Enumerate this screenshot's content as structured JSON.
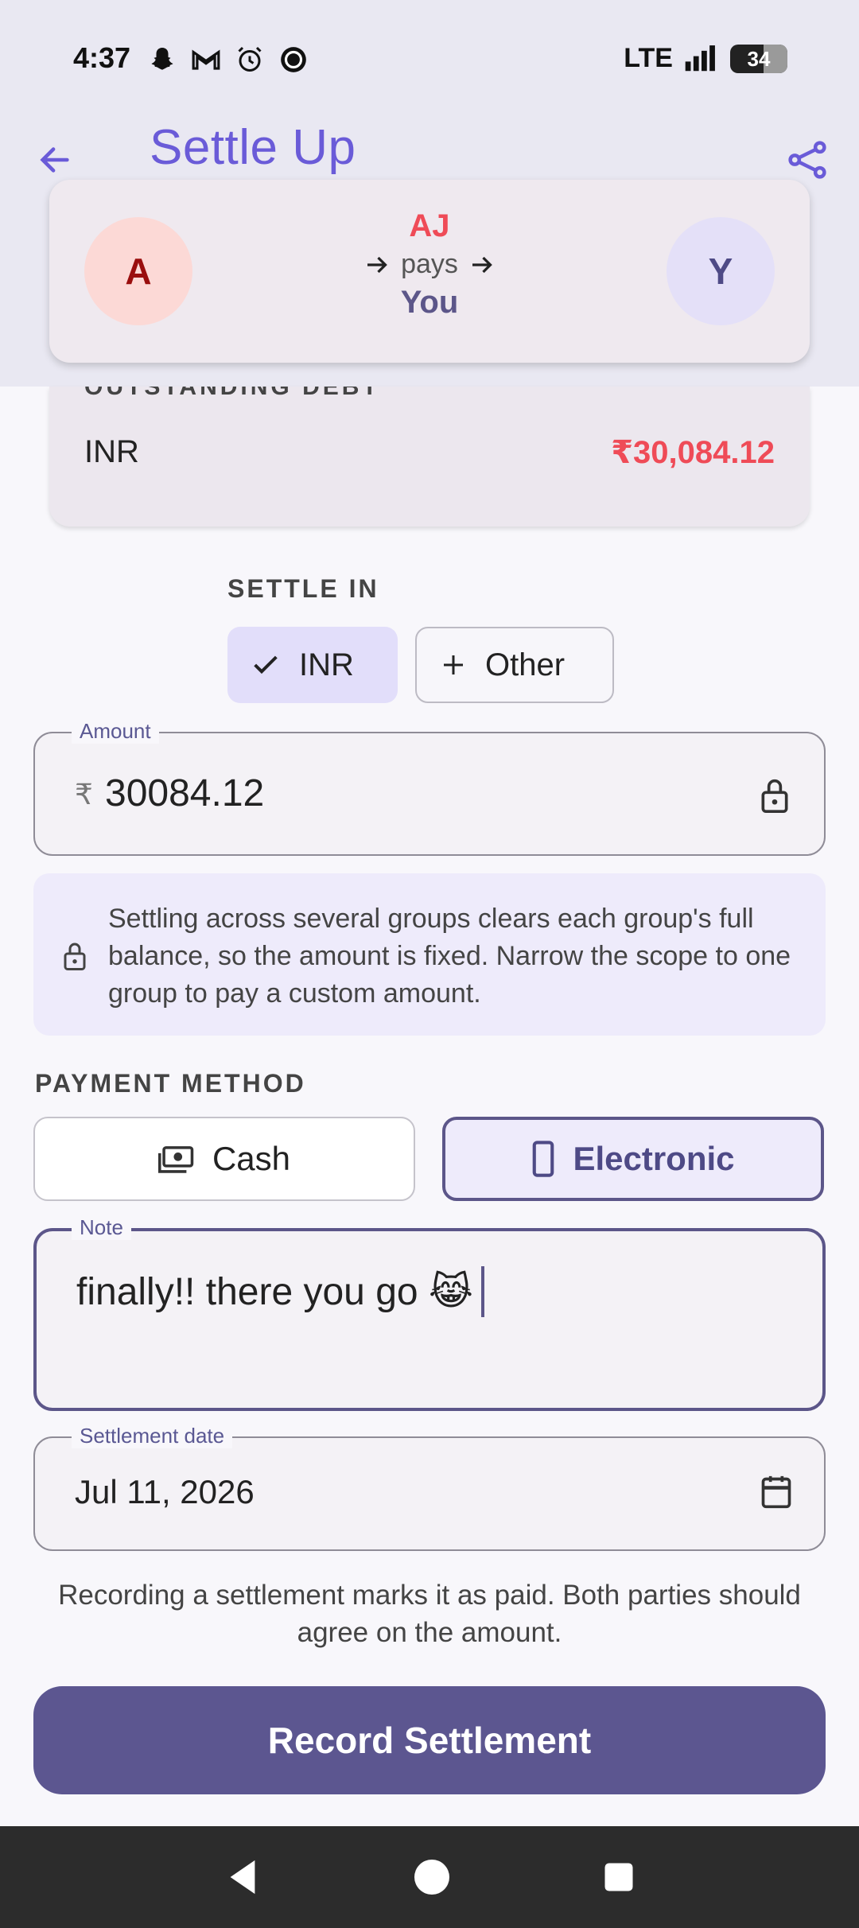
{
  "status_bar": {
    "time": "4:37",
    "network": "LTE",
    "battery": "34"
  },
  "app_bar": {
    "title": "Settle Up"
  },
  "payment_summary": {
    "payer_initial": "A",
    "payer_name": "AJ",
    "verb": "pays",
    "payee_name": "You",
    "payee_initial": "Y"
  },
  "debt": {
    "label": "OUTSTANDING DEBT",
    "currency": "INR",
    "amount": "₹30,084.12"
  },
  "settle_in": {
    "label": "SETTLE IN",
    "selected": "INR",
    "other": "Other"
  },
  "amount_field": {
    "label": "Amount",
    "symbol": "₹",
    "value": "30084.12"
  },
  "info": {
    "text": "Settling across several groups clears each group's full balance, so the amount is fixed. Narrow the scope to one group to pay a custom amount."
  },
  "payment_method": {
    "label": "PAYMENT METHOD",
    "cash": "Cash",
    "electronic": "Electronic",
    "selected": "Electronic"
  },
  "note_field": {
    "label": "Note",
    "value": "finally!! there you go 😹"
  },
  "date_field": {
    "label": "Settlement date",
    "value": "Jul 11, 2026"
  },
  "disclaimer": "Recording a settlement marks it as paid. Both parties should agree on the amount.",
  "record_button": "Record Settlement",
  "colors": {
    "accent": "#6a5bd8",
    "primary": "#5c5690",
    "debt": "#ef4b57"
  }
}
